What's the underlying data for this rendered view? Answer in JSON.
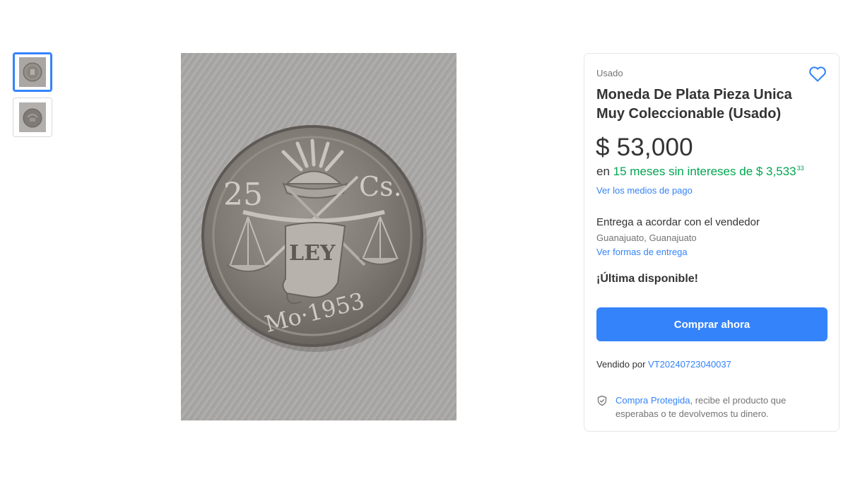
{
  "gallery": {
    "thumbnails": [
      {
        "icon": "coin-thumbnail",
        "selected": true
      },
      {
        "icon": "coin-thumbnail",
        "selected": false
      }
    ],
    "main_image": {
      "icon": "silver-coin-photo",
      "coin_text": {
        "denomination": "25",
        "unit": "Cs.",
        "motto": "LEY",
        "mint_year": "Mo·1953"
      }
    }
  },
  "product": {
    "condition": "Usado",
    "title": "Moneda De Plata Pieza Unica Muy Coleccionable (Usado)",
    "price": "$ 53,000",
    "installments": {
      "prefix": "en",
      "highlight": "15 meses sin intereses de $ 3,533",
      "cents": "33"
    },
    "payment_link": "Ver los medios de pago",
    "delivery": {
      "text": "Entrega a acordar con el vendedor",
      "location": "Guanajuato, Guanajuato",
      "link": "Ver formas de entrega"
    },
    "stock": "¡Última disponible!",
    "buy_button": "Comprar ahora",
    "seller": {
      "label": "Vendido por",
      "name": "VT20240723040037"
    },
    "protection": {
      "link": "Compra Protegida",
      "text": ", recibe el producto que esperabas o te devolvemos tu dinero."
    }
  },
  "colors": {
    "accent": "#3483fa",
    "green": "#00a650",
    "text": "#333333",
    "muted": "#737373"
  }
}
